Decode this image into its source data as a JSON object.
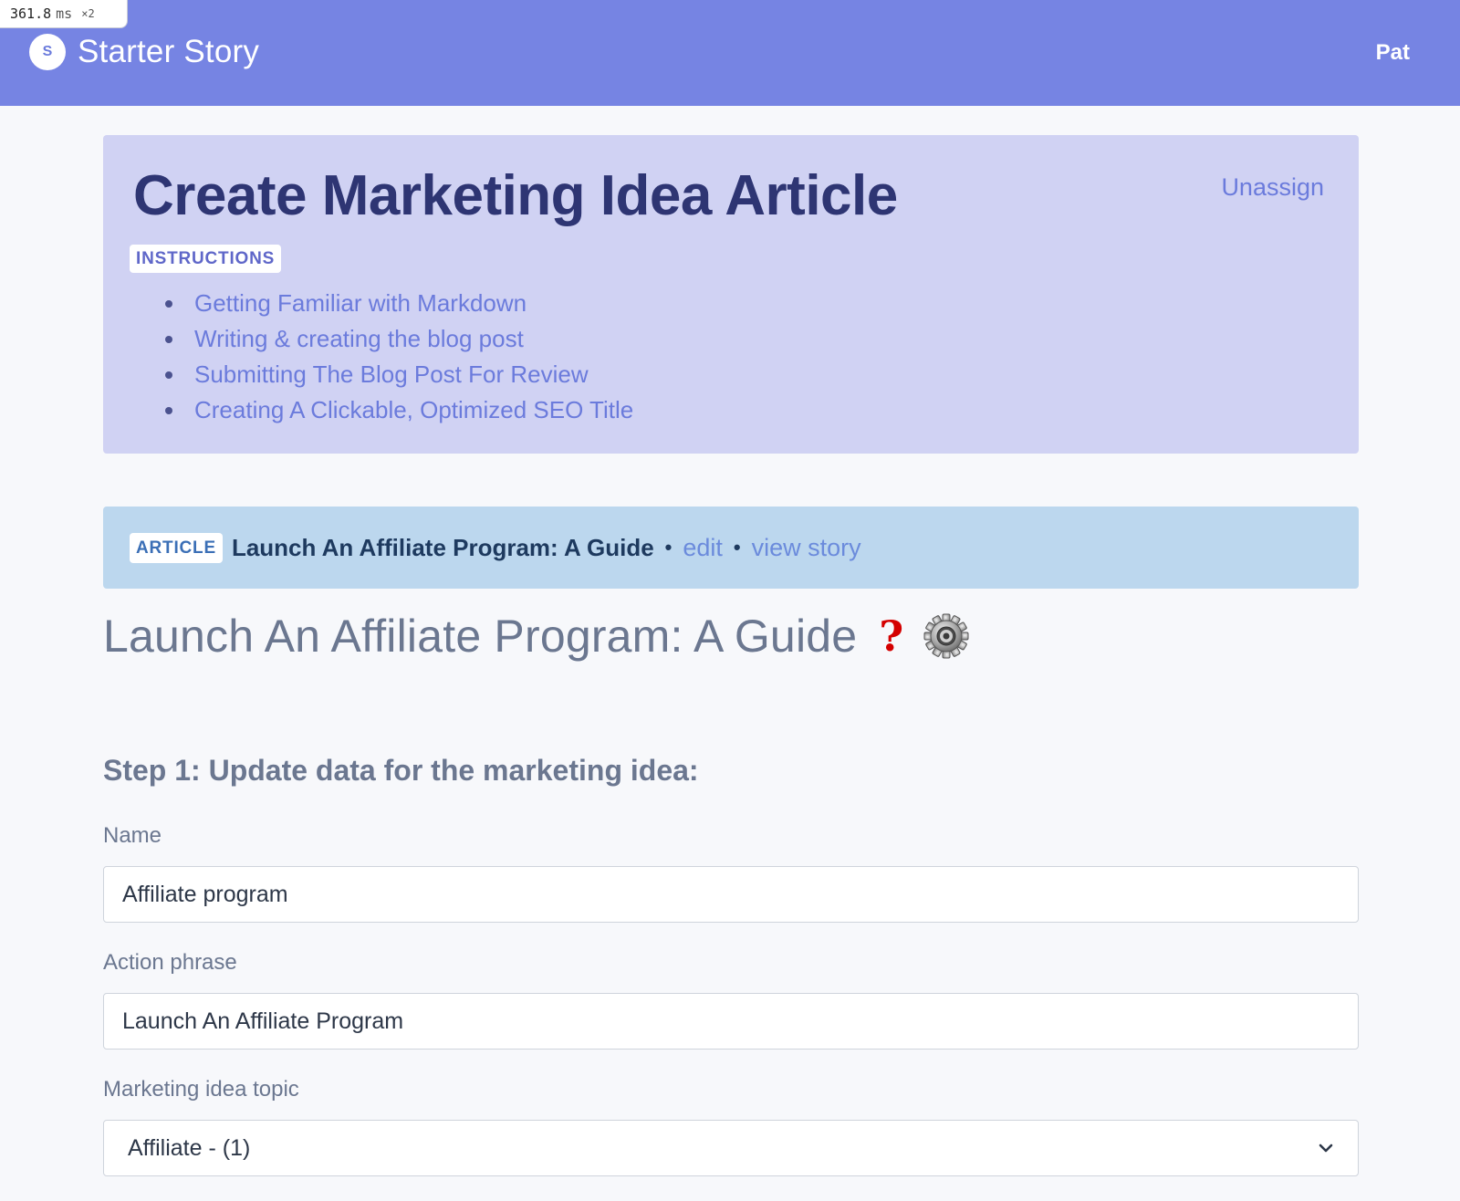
{
  "perf": {
    "value": "361.8",
    "unit": "ms",
    "multiplier": "×2"
  },
  "nav": {
    "logo_letter": "S",
    "brand": "Starter Story",
    "user": "Pat"
  },
  "task": {
    "title": "Create Marketing Idea Article",
    "unassign_label": "Unassign",
    "instructions_badge": "INSTRUCTIONS",
    "instructions": [
      "Getting Familiar with Markdown",
      "Writing & creating the blog post",
      "Submitting The Blog Post For Review",
      "Creating A Clickable, Optimized SEO Title"
    ]
  },
  "article": {
    "badge": "ARTICLE",
    "name": "Launch An Affiliate Program: A Guide",
    "separator": "•",
    "edit_label": "edit",
    "view_label": "view story"
  },
  "story": {
    "heading": "Launch An Affiliate Program: A Guide",
    "help_icon": "question-mark-icon",
    "settings_icon": "gear-icon"
  },
  "form": {
    "step_heading": "Step 1: Update data for the marketing idea:",
    "name_label": "Name",
    "name_value": "Affiliate program",
    "action_label": "Action phrase",
    "action_value": "Launch An Affiliate Program",
    "topic_label": "Marketing idea topic",
    "topic_value": "Affiliate - (1)"
  },
  "colors": {
    "nav_bg": "#7684e3",
    "task_card_bg": "#d0d2f3",
    "article_bar_bg": "#bcd7ee",
    "link": "#6b7bdc",
    "title": "#2e3573"
  }
}
